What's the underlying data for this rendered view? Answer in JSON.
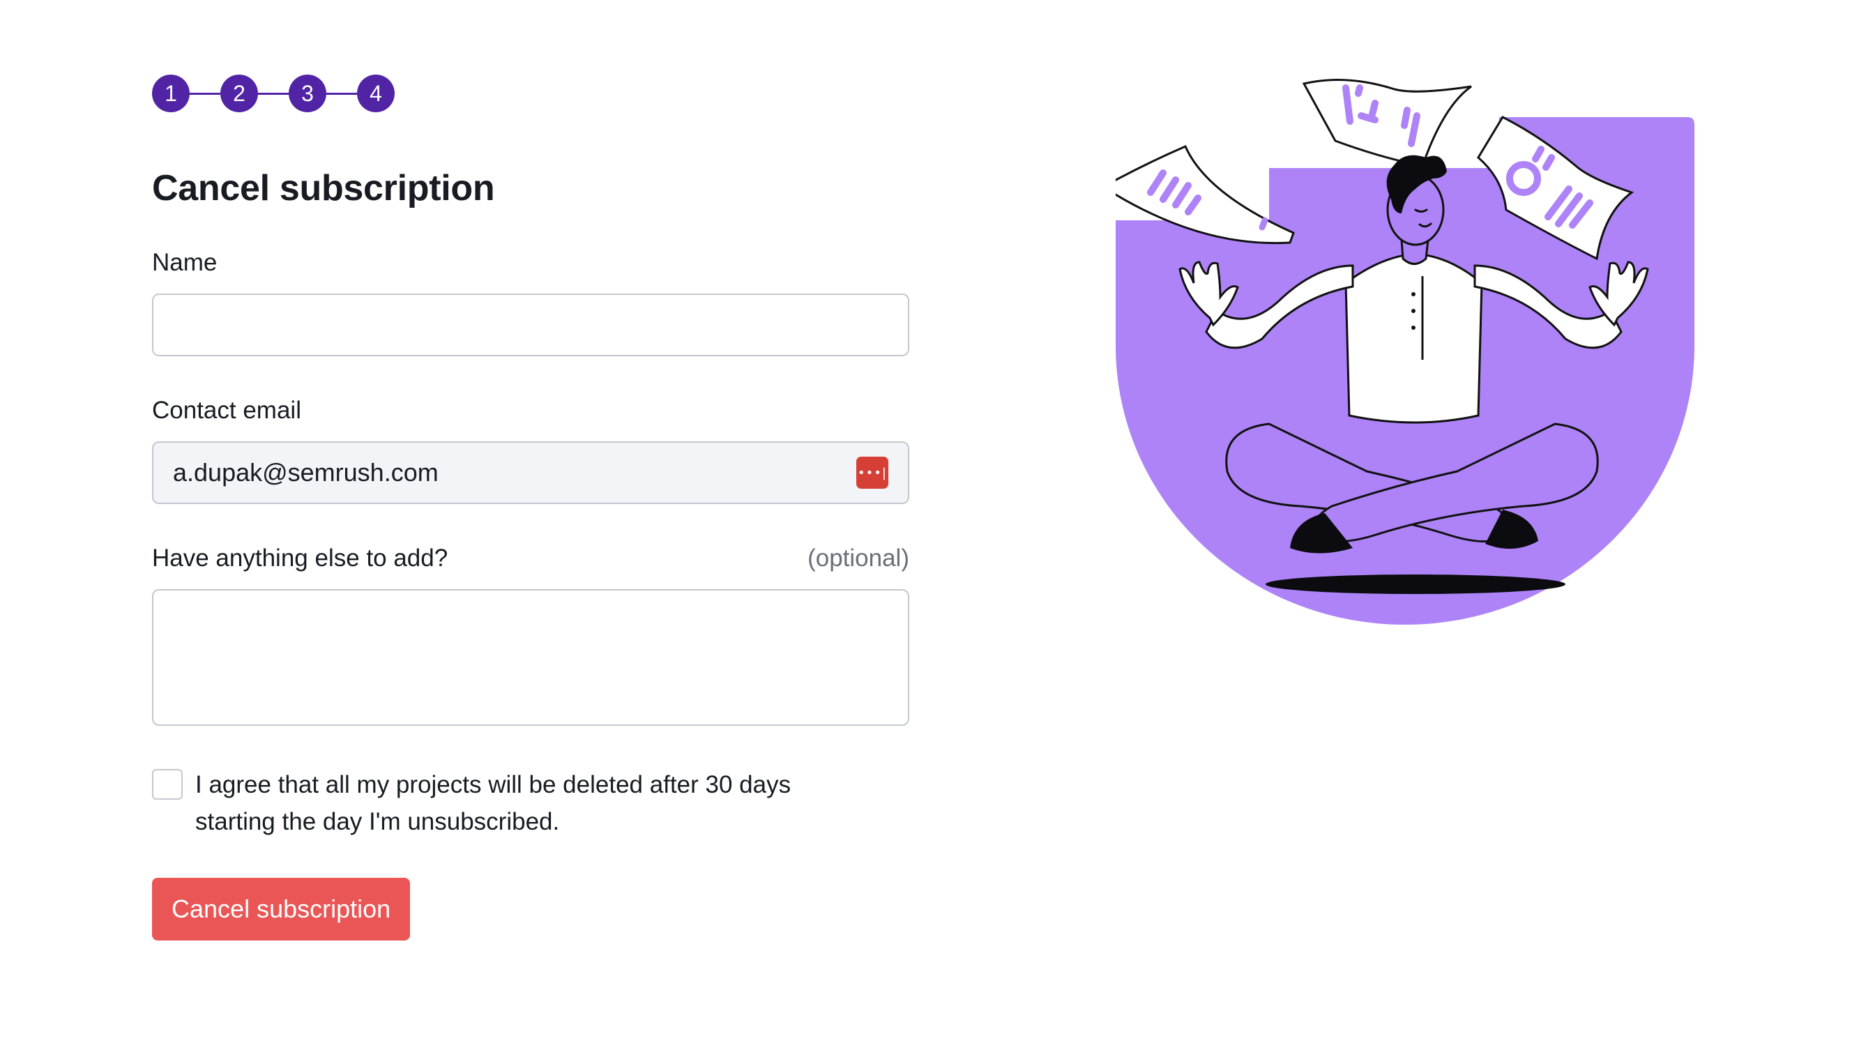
{
  "stepper": {
    "steps": [
      "1",
      "2",
      "3",
      "4"
    ]
  },
  "page_title": "Cancel subscription",
  "fields": {
    "name": {
      "label": "Name",
      "value": ""
    },
    "email": {
      "label": "Contact email",
      "value": "a.dupak@semrush.com",
      "autofill_icon": "password-manager-icon"
    },
    "comment": {
      "label": "Have anything else to add?",
      "optional_label": "(optional)",
      "value": ""
    }
  },
  "agreement": {
    "text": "I agree that all my projects will be deleted after 30 days starting the day I'm unsubscribed.",
    "checked": false
  },
  "submit_label": "Cancel subscription",
  "colors": {
    "step": "#5124a6",
    "accent_purple": "#ad83f7",
    "danger_button": "#ea5656",
    "autofill_icon": "#d63f36"
  },
  "illustration": {
    "icon": "meditating-person-with-floating-documents"
  }
}
